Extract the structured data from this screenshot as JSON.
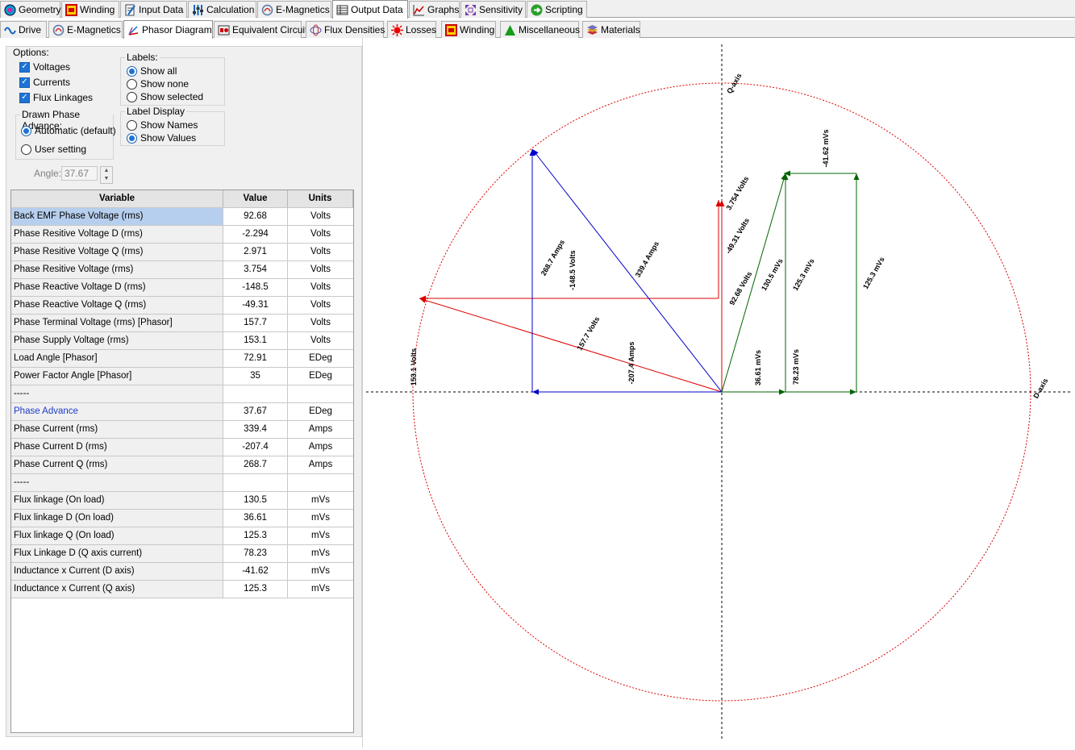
{
  "main_tabs": [
    {
      "label": "Geometry",
      "icon": "geometry-icon"
    },
    {
      "label": "Winding",
      "icon": "winding-icon"
    },
    {
      "label": "Input Data",
      "icon": "input-data-icon"
    },
    {
      "label": "Calculation",
      "icon": "calculation-icon"
    },
    {
      "label": "E-Magnetics",
      "icon": "e-magnetics-icon"
    },
    {
      "label": "Output Data",
      "icon": "output-data-icon",
      "active": true
    },
    {
      "label": "Graphs",
      "icon": "graphs-icon"
    },
    {
      "label": "Sensitivity",
      "icon": "sensitivity-icon"
    },
    {
      "label": "Scripting",
      "icon": "scripting-icon"
    }
  ],
  "sub_tabs": [
    {
      "label": "Drive",
      "icon": "drive-icon"
    },
    {
      "label": "E-Magnetics",
      "icon": "e-magnetics-icon"
    },
    {
      "label": "Phasor Diagram",
      "icon": "phasor-diagram-icon",
      "active": true
    },
    {
      "label": "Equivalent Circuit",
      "icon": "equivalent-circuit-icon"
    },
    {
      "label": "Flux Densities",
      "icon": "flux-densities-icon"
    },
    {
      "label": "Losses",
      "icon": "losses-icon"
    },
    {
      "label": "Winding",
      "icon": "winding-icon"
    },
    {
      "label": "Miscellaneous",
      "icon": "miscellaneous-icon"
    },
    {
      "label": "Materials",
      "icon": "materials-icon"
    }
  ],
  "options": {
    "title": "Options:",
    "voltages": "Voltages",
    "currents": "Currents",
    "flux_linkages": "Flux Linkages"
  },
  "labels_group": {
    "title": "Labels:",
    "show_all": "Show all",
    "show_none": "Show none",
    "show_selected": "Show selected",
    "selected": "Show all"
  },
  "phase_advance_group": {
    "title": "Drawn Phase Advance:",
    "automatic": "Automatic (default)",
    "user": "User setting",
    "selected": "Automatic (default)",
    "angle_label": "Angle:",
    "angle_value": "37.67"
  },
  "label_display_group": {
    "title": "Label Display",
    "show_names": "Show Names",
    "show_values": "Show Values",
    "selected": "Show Values"
  },
  "table": {
    "headers": [
      "Variable",
      "Value",
      "Units"
    ],
    "rows": [
      [
        "Back EMF Phase Voltage (rms)",
        "92.68",
        "Volts"
      ],
      [
        "Phase Resitive Voltage D (rms)",
        "-2.294",
        "Volts"
      ],
      [
        "Phase Resitive Voltage Q (rms)",
        "2.971",
        "Volts"
      ],
      [
        "Phase Resitive Voltage (rms)",
        "3.754",
        "Volts"
      ],
      [
        "Phase Reactive Voltage D (rms)",
        "-148.5",
        "Volts"
      ],
      [
        "Phase Reactive Voltage Q (rms)",
        "-49.31",
        "Volts"
      ],
      [
        "Phase Terminal Voltage (rms) [Phasor]",
        "157.7",
        "Volts"
      ],
      [
        "Phase Supply Voltage (rms)",
        "153.1",
        "Volts"
      ],
      [
        "Load Angle [Phasor]",
        "72.91",
        "EDeg"
      ],
      [
        "Power Factor Angle [Phasor]",
        "35",
        "EDeg"
      ],
      [
        "-----",
        "",
        ""
      ],
      [
        "Phase Advance",
        "37.67",
        "EDeg"
      ],
      [
        "Phase Current (rms)",
        "339.4",
        "Amps"
      ],
      [
        "Phase Current D (rms)",
        "-207.4",
        "Amps"
      ],
      [
        "Phase Current Q (rms)",
        "268.7",
        "Amps"
      ],
      [
        "-----",
        "",
        ""
      ],
      [
        "Flux linkage (On load)",
        "130.5",
        "mVs"
      ],
      [
        "Flux linkage D (On load)",
        "36.61",
        "mVs"
      ],
      [
        "Flux linkage Q (On load)",
        "125.3",
        "mVs"
      ],
      [
        "Flux Linkage D (Q axis current)",
        "78.23",
        "mVs"
      ],
      [
        "Inductance x Current (D axis)",
        "-41.62",
        "mVs"
      ],
      [
        "Inductance x Current (Q axis)",
        "125.3",
        "mVs"
      ]
    ]
  },
  "diagram": {
    "q_axis_label": "Q-axis",
    "d_axis_label": "D-axis",
    "colors": {
      "voltage": "#dd0000",
      "current": "#0000cc",
      "flux": "#006400",
      "circle": "#dd0000",
      "axis": "#000000"
    },
    "labels": {
      "supply": "153.1 Volts",
      "terminal": "157.7 Volts",
      "current_d": "-207.4 Amps",
      "current_q": "268.7 Amps",
      "current_mag": "339.4 Amps",
      "reactive_d": "-148.5 Volts",
      "reactive_q": "-49.31 Volts",
      "resistive": "3.754 Volts",
      "back_emf": "92.68 Volts",
      "flux_load": "130.5 mVs",
      "flux_d": "36.61 mVs",
      "flux_q": "125.3 mVs",
      "flux_q2": "125.3 mVs",
      "flux_dq": "78.23 mVs",
      "ind_d": "-41.62 mVs"
    }
  }
}
